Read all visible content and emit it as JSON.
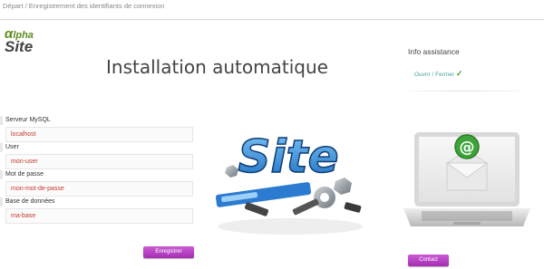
{
  "breadcrumb": "Départ / Enregistrement des identifiants de connexion",
  "logo": {
    "alpha": "lpha",
    "alpha_mark": "α",
    "site": "Site"
  },
  "page_title": "Installation automatique",
  "form": {
    "fields": [
      {
        "label": "Serveur MySQL",
        "value": "localhost"
      },
      {
        "label": "User",
        "value": "mon-user"
      },
      {
        "label": "Mot de passe",
        "value": "mon-mot-de-passe"
      },
      {
        "label": "Base de données",
        "value": "ma-base"
      }
    ],
    "submit_label": "Enregistrer"
  },
  "illustration": {
    "word": "Site"
  },
  "info": {
    "title": "Info assistance",
    "toggle_label": "Ouvrir / Fermer",
    "contact_label": "Contact"
  },
  "colors": {
    "accent": "#a62db3",
    "link": "#4aa3a3",
    "value_text": "#c0392b",
    "check": "#3aa52b"
  }
}
